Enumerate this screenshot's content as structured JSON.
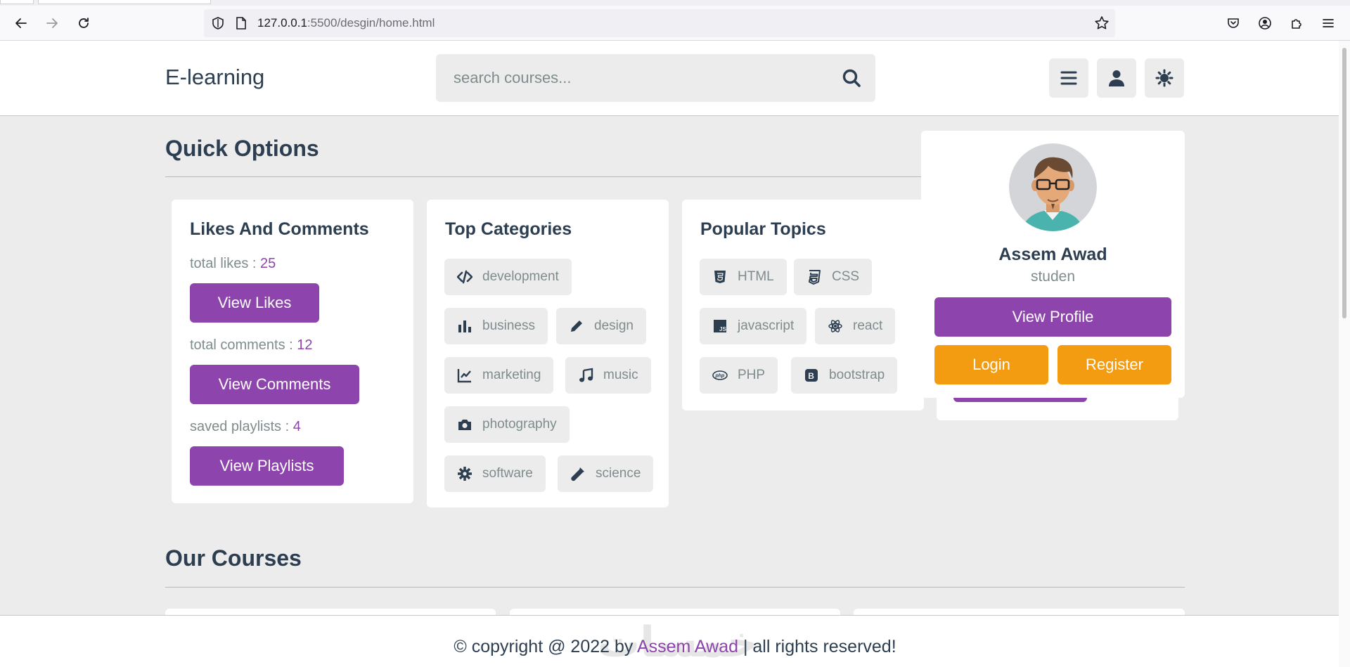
{
  "browser": {
    "url_host": "127.0.0.1",
    "url_rest": ":5500/desgin/home.html"
  },
  "header": {
    "logo": "E-learning",
    "search_placeholder": "search courses..."
  },
  "quick_options": {
    "title": "Quick Options",
    "likes_box": {
      "title": "Likes And Comments",
      "likes_label": "total likes : ",
      "likes_value": "25",
      "likes_button": "View Likes",
      "comments_label": "total comments : ",
      "comments_value": "12",
      "comments_button": "View Comments",
      "playlists_label": "saved playlists : ",
      "playlists_value": "4",
      "playlists_button": "View Playlists"
    },
    "categories_box": {
      "title": "Top Categories",
      "tags": [
        {
          "label": "development",
          "icon": "code-icon"
        },
        {
          "label": "business",
          "icon": "chart-bar-icon"
        },
        {
          "label": "design",
          "icon": "pen-icon"
        },
        {
          "label": "marketing",
          "icon": "chart-line-icon"
        },
        {
          "label": "music",
          "icon": "music-icon"
        },
        {
          "label": "photography",
          "icon": "camera-icon"
        },
        {
          "label": "software",
          "icon": "gear-icon"
        },
        {
          "label": "science",
          "icon": "vial-icon"
        }
      ]
    },
    "topics_box": {
      "title": "Popular Topics",
      "tags": [
        {
          "label": "HTML",
          "icon": "html5-icon"
        },
        {
          "label": "CSS",
          "icon": "css3-icon"
        },
        {
          "label": "javascript",
          "icon": "js-icon"
        },
        {
          "label": "react",
          "icon": "react-icon"
        },
        {
          "label": "PHP",
          "icon": "php-icon"
        },
        {
          "label": "bootstrap",
          "icon": "bootstrap-icon"
        }
      ]
    }
  },
  "profile": {
    "name": "Assem Awad",
    "role": "studen",
    "view_profile": "View Profile",
    "login": "Login",
    "register": "Register"
  },
  "courses": {
    "title": "Our Courses"
  },
  "footer": {
    "prefix": "© copyright @ 2022 by ",
    "author": "Assem Awad",
    "suffix": " | all rights reserved!",
    "watermark": "خمسات"
  },
  "colors": {
    "accent": "#8e44ad",
    "orange": "#f39c12",
    "text": "#2c3e50",
    "muted": "#7f8c8d",
    "background": "#ececec"
  }
}
